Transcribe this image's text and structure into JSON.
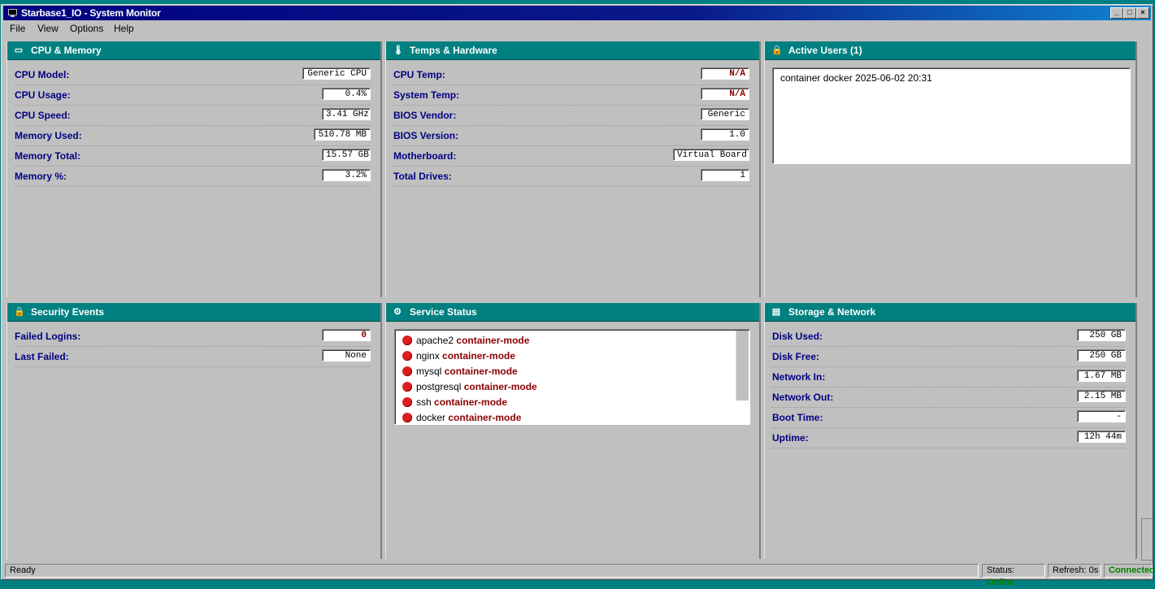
{
  "window": {
    "title": "Starbase1_IO - System Monitor"
  },
  "menu": [
    "File",
    "View",
    "Options",
    "Help"
  ],
  "panels": {
    "cpu_memory": {
      "title": "CPU & Memory",
      "rows": [
        {
          "label": "CPU Model:",
          "value": "Generic CPU"
        },
        {
          "label": "CPU Usage:",
          "value": "0.4%"
        },
        {
          "label": "CPU Speed:",
          "value": "3.41 GHz"
        },
        {
          "label": "Memory Used:",
          "value": "510.78 MB"
        },
        {
          "label": "Memory Total:",
          "value": "15.57 GB"
        },
        {
          "label": "Memory %:",
          "value": "3.2%"
        }
      ]
    },
    "temps_hardware": {
      "title": "Temps & Hardware",
      "rows": [
        {
          "label": "CPU Temp:",
          "value": "N/A"
        },
        {
          "label": "System Temp:",
          "value": "N/A"
        },
        {
          "label": "BIOS Vendor:",
          "value": "Generic"
        },
        {
          "label": "BIOS Version:",
          "value": "1.0"
        },
        {
          "label": "Motherboard:",
          "value": "Virtual Board"
        },
        {
          "label": "Total Drives:",
          "value": "1"
        }
      ]
    },
    "active_users": {
      "title": "Active Users (1)",
      "users": [
        "container docker 2025-06-02 20:31"
      ]
    },
    "security_events": {
      "title": "Security Events",
      "rows": [
        {
          "label": "Failed Logins:",
          "value": "0"
        },
        {
          "label": "Last Failed:",
          "value": "None"
        }
      ]
    },
    "service_status": {
      "title": "Service Status",
      "services": [
        {
          "name": "apache2",
          "state": "container-mode"
        },
        {
          "name": "nginx",
          "state": "container-mode"
        },
        {
          "name": "mysql",
          "state": "container-mode"
        },
        {
          "name": "postgresql",
          "state": "container-mode"
        },
        {
          "name": "ssh",
          "state": "container-mode"
        },
        {
          "name": "docker",
          "state": "container-mode"
        }
      ]
    },
    "storage_network": {
      "title": "Storage & Network",
      "rows": [
        {
          "label": "Disk Used:",
          "value": "250 GB"
        },
        {
          "label": "Disk Free:",
          "value": "250 GB"
        },
        {
          "label": "Network In:",
          "value": "1.67 MB"
        },
        {
          "label": "Network Out:",
          "value": "2.15 MB"
        },
        {
          "label": "Boot Time:",
          "value": "-"
        },
        {
          "label": "Uptime:",
          "value": "12h 44m"
        }
      ]
    }
  },
  "statusbar": {
    "message": "Ready",
    "status_label": "Status:",
    "status_value": "Online",
    "refresh": "Refresh: 0s",
    "connection": "Connected"
  },
  "colors": {
    "accent": "#008080",
    "label": "#000080",
    "alert": "#8b0000",
    "online": "#008000",
    "service_dot": "#dc1e1e"
  },
  "icons": {
    "cpu_memory": "monitor-icon",
    "temps_hardware": "thermometer-icon",
    "active_users": "lock-icon",
    "security_events": "lock-icon",
    "service_status": "gear-icon",
    "storage_network": "disk-icon"
  }
}
